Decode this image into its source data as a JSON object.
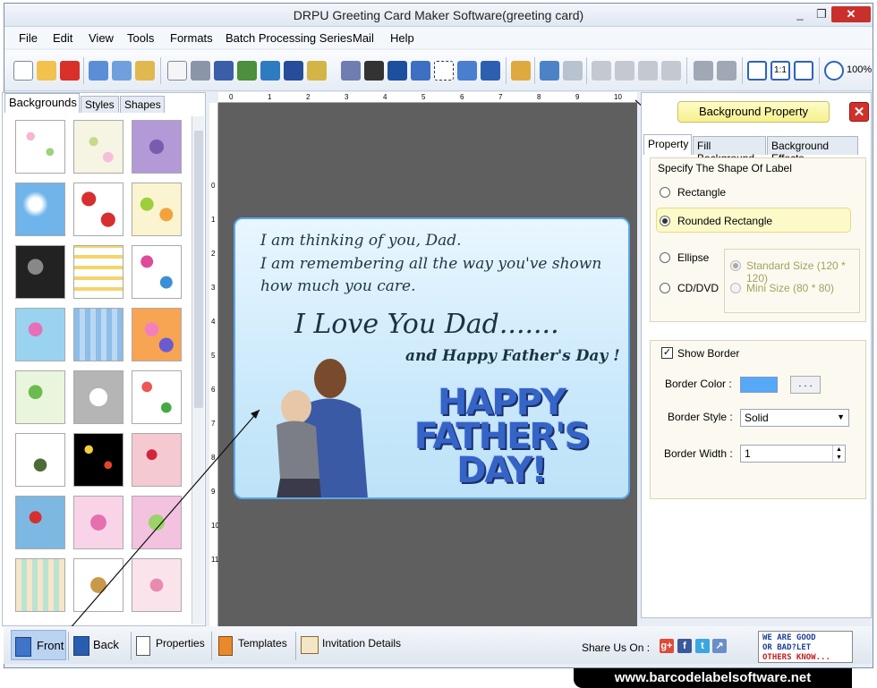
{
  "window": {
    "title": "DRPU Greeting Card Maker Software(greeting card)",
    "min": "_",
    "max": "❐",
    "close": "✕"
  },
  "menu": [
    "File",
    "Edit",
    "View",
    "Tools",
    "Formats",
    "Batch Processing Series",
    "Mail",
    "Help"
  ],
  "toolbar": {
    "zoom": "100%"
  },
  "left_panel": {
    "tabs": [
      "Backgrounds",
      "Styles",
      "Shapes"
    ],
    "active_tab": "Backgrounds"
  },
  "card": {
    "line1": "I am thinking of you, Dad.",
    "line2": "I am remembering  all the way you've shown",
    "line3": "how much you care.",
    "headline": "I Love You Dad.......",
    "subline": "and Happy Father's Day !",
    "art_line1": "HAPPY",
    "art_line2": "FATHER'S",
    "art_line3": "DAY!"
  },
  "right_panel": {
    "header": "Background Property",
    "close": "✕",
    "tabs": [
      "Property",
      "Fill Background",
      "Background Effects"
    ],
    "active_tab": "Property",
    "shape_group_title": "Specify The Shape Of Label",
    "shapes": [
      {
        "label": "Rectangle",
        "selected": false
      },
      {
        "label": "Rounded Rectangle",
        "selected": true
      },
      {
        "label": "Ellipse",
        "selected": false
      },
      {
        "label": "CD/DVD",
        "selected": false
      }
    ],
    "sizes": [
      {
        "label": "Standard Size (120 * 120)",
        "selected": true
      },
      {
        "label": "Mini Size (80 * 80)",
        "selected": false
      }
    ],
    "show_border_label": "Show Border",
    "show_border_checked": true,
    "border_color_label": "Border Color :",
    "border_color": "#58a8f8",
    "border_color_btn": ". . .",
    "border_style_label": "Border Style :",
    "border_style_value": "Solid",
    "border_width_label": "Border Width :",
    "border_width_value": "1"
  },
  "bottom_bar": {
    "front": "Front",
    "back": "Back",
    "properties": "Properties",
    "templates": "Templates",
    "invitation": "Invitation Details",
    "share": "Share Us On :",
    "ad_line1": "WE ARE GOOD",
    "ad_line2": "OR BAD?LET",
    "ad_line3": "OTHERS KNOW..."
  },
  "footer": "www.barcodelabelsoftware.net",
  "colors": {
    "accent": "#58a8f8",
    "card_border": "#5ba5ec",
    "card_text": "#1c3244",
    "happy_text": "#3564c7"
  }
}
